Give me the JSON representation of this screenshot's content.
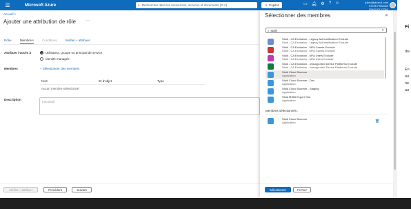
{
  "topbar": {
    "app_name": "Microsoft Azure",
    "search_placeholder": "Rechercher dans les ressources, services et documents (G+/)",
    "copilot_label": "Copilot",
    "user_email": "julien@phoko1.com",
    "user_tenant": "STOIK FRANCE (PHOKO1.COM)"
  },
  "page": {
    "breadcrumb": "Accueil",
    "title": "Ajouter une attribution de rôle",
    "more": "···",
    "tabs": [
      {
        "label": "Rôle",
        "marker": "*"
      },
      {
        "label": "Membres",
        "marker": "*"
      },
      {
        "label": "Conditions",
        "marker": ""
      },
      {
        "label": "Vérifier + attribuer",
        "marker": ""
      }
    ],
    "assign_access_label": "Attribuer l’accès à",
    "option_user": "Utilisateur, groupe ou principal de service",
    "option_managed": "Identité managée",
    "members_label": "Membres",
    "select_members_link": "+ Sélectionner des membres",
    "columns": [
      "Nom",
      "ID d’objet",
      "Type"
    ],
    "no_member": "Aucun membre sélectionné",
    "description_label": "Description",
    "description_placeholder": "Facultatif",
    "btn_review": "Vérifier + attribuer",
    "btn_prev": "Précédent",
    "btn_next": "Suivant"
  },
  "panel": {
    "title": "Sélectionner des membres",
    "close": "✕",
    "search_value": "stoik",
    "results": [
      {
        "name": "Stoik - CA Exclusion - Legacy Authentification Exclude",
        "sub": "Stoik - CA Exclusion - Legacy Authentification Exclude",
        "color": "#6b8ed1"
      },
      {
        "name": "Stoik - CA Exclusion - MFA Guests Exclude",
        "sub": "Stoik - CA Exclusion - MFA Guests Exclude",
        "color": "#d13438"
      },
      {
        "name": "Stoik - CA Exclusion - MFA Users Exclude",
        "sub": "Stoik - CA Exclusion - MFA Users Exclude",
        "color": "#c239b3"
      },
      {
        "name": "Stoik - CA Exclusion - Unsupported Device Platforms Exclude",
        "sub": "Stoik - CA Exclusion - Unsupported Device Platforms Exclude",
        "color": "#107c41"
      },
      {
        "name": "Stoik Cloud Scanner",
        "sub": "Application",
        "color": "#3a96dd"
      },
      {
        "name": "Stoik Cloud Scanner - Dev",
        "sub": "Application",
        "color": "#3a96dd"
      },
      {
        "name": "Stoik Cloud Scanner - Staging",
        "sub": "Application",
        "color": "#3a96dd"
      },
      {
        "name": "Stoik M365 Export Test",
        "sub": "Application",
        "color": "#3a96dd"
      }
    ],
    "selected_title": "Membres sélectionnés :",
    "selected": [
      {
        "name": "Stoik Cloud Scanner",
        "sub": "Application",
        "color": "#3a96dd"
      }
    ],
    "btn_select": "Sélectionner",
    "btn_close": "Fermer"
  },
  "rightpane": {
    "text1": "Fi",
    "text2": "dis",
    "text3": "En",
    "text4": "au",
    "text5": "ne",
    "text6": "au"
  }
}
